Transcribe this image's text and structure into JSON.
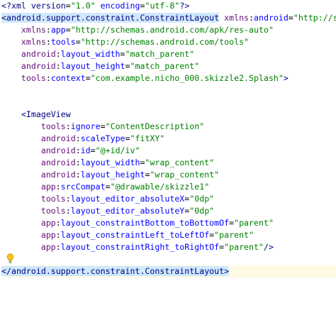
{
  "editor": {
    "lines": [
      {
        "text": "<?xml version=\"1.0\" encoding=\"utf-8\"?>"
      },
      {
        "text": "<android.support.constraint.ConstraintLayout xmlns:android=\"http://schemas.android.com/apk/res/android\""
      },
      {
        "text": "    xmlns:app=\"http://schemas.android.com/apk/res-auto\""
      },
      {
        "text": "    xmlns:tools=\"http://schemas.android.com/tools\""
      },
      {
        "text": "    android:layout_width=\"match_parent\""
      },
      {
        "text": "    android:layout_height=\"match_parent\""
      },
      {
        "text": "    tools:context=\"com.example.nicho_000.skizzle2.Splash\">"
      },
      {
        "text": ""
      },
      {
        "text": ""
      },
      {
        "text": "    <ImageView"
      },
      {
        "text": "        tools:ignore=\"ContentDescription\""
      },
      {
        "text": "        android:scaleType=\"fitXY\""
      },
      {
        "text": "        android:id=\"@+id/iv\""
      },
      {
        "text": "        android:layout_width=\"wrap_content\""
      },
      {
        "text": "        android:layout_height=\"wrap_content\""
      },
      {
        "text": "        app:srcCompat=\"@drawable/skizzle1\""
      },
      {
        "text": "        tools:layout_editor_absoluteX=\"0dp\""
      },
      {
        "text": "        tools:layout_editor_absoluteY=\"0dp\""
      },
      {
        "text": "        app:layout_constraintBottom_toBottomOf=\"parent\""
      },
      {
        "text": "        app:layout_constraintLeft_toLeftOf=\"parent\""
      },
      {
        "text": "        app:layout_constraintRight_toRightOf=\"parent\"/>"
      },
      {
        "text": ""
      },
      {
        "text": "</android.support.constraint.ConstraintLayout>"
      }
    ],
    "caret_line": 22,
    "colors": {
      "background": "#ffffff",
      "tag": "#000080",
      "attribute": "#0000ff",
      "namespace": "#660e7a",
      "string": "#008000",
      "tag_highlight": "#cfe8fc",
      "caret_line": "#fffae3",
      "bulb": "#f5c518"
    },
    "gutter_icon": "lightbulb-icon"
  }
}
